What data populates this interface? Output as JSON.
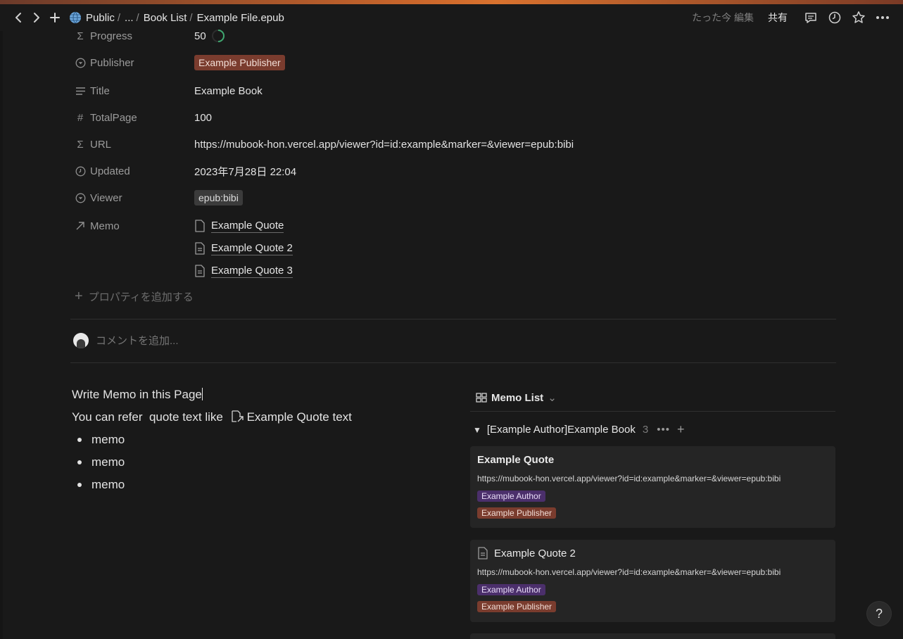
{
  "breadcrumb": {
    "items": [
      "Public",
      "...",
      "Book List",
      "Example File.epub"
    ],
    "separator": "/"
  },
  "topbar": {
    "edited": "たった今 編集",
    "share": "共有"
  },
  "properties": [
    {
      "label": "Progress",
      "icon": "sigma-icon",
      "value": "50"
    },
    {
      "label": "Publisher",
      "icon": "select-icon",
      "value": "Example Publisher"
    },
    {
      "label": "Title",
      "icon": "text-icon",
      "value": "Example Book"
    },
    {
      "label": "TotalPage",
      "icon": "hash-icon",
      "value": "100"
    },
    {
      "label": "URL",
      "icon": "sigma-icon",
      "value": "https://mubook-hon.vercel.app/viewer?id=id:example&marker=&viewer=epub:bibi"
    },
    {
      "label": "Updated",
      "icon": "clock-icon",
      "value": "2023年7月28日 22:04"
    },
    {
      "label": "Viewer",
      "icon": "select-icon",
      "value": "epub:bibi"
    },
    {
      "label": "Memo",
      "icon": "relation-arrow-icon",
      "value": ""
    }
  ],
  "memo_links": [
    "Example Quote",
    "Example Quote 2",
    "Example Quote 3"
  ],
  "add_property": "プロパティを追加する",
  "comment_placeholder": "コメントを追加...",
  "body": {
    "line1": "Write Memo in this Page",
    "line2_prefix": "You can refer  quote text like ",
    "line2_link": "Example Quote",
    "line2_suffix": " text",
    "bullets": [
      "memo",
      "memo",
      "memo"
    ]
  },
  "memo_list": {
    "view_name": "Memo List",
    "group_name": "[Example Author]Example Book",
    "group_count": "3",
    "cards": [
      {
        "title": "Example Quote",
        "url": "https://mubook-hon.vercel.app/viewer?id=id:example&marker=&viewer=epub:bibi",
        "author": "Example Author",
        "publisher": "Example Publisher"
      },
      {
        "title": "Example Quote 2",
        "url": "https://mubook-hon.vercel.app/viewer?id=id:example&marker=&viewer=epub:bibi",
        "author": "Example Author",
        "publisher": "Example Publisher"
      }
    ]
  },
  "help_label": "?",
  "colors": {
    "background": "#191919",
    "publisher_tag": "#7a3c2e",
    "author_tag": "#4b2f6b",
    "progress_ring": "#3fa870"
  }
}
